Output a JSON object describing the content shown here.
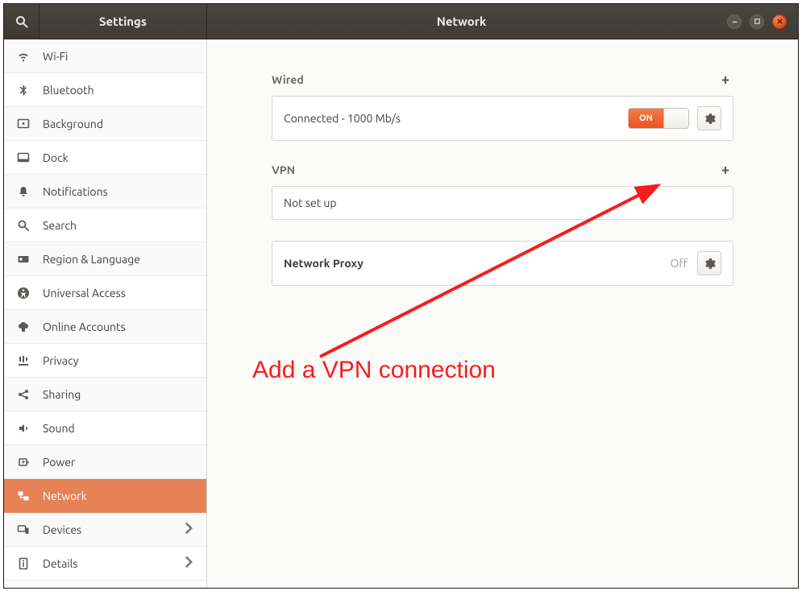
{
  "titlebar": {
    "sidebar_title": "Settings",
    "main_title": "Network"
  },
  "sidebar": {
    "items": [
      {
        "label": "Wi-Fi"
      },
      {
        "label": "Bluetooth"
      },
      {
        "label": "Background"
      },
      {
        "label": "Dock"
      },
      {
        "label": "Notifications"
      },
      {
        "label": "Search"
      },
      {
        "label": "Region & Language"
      },
      {
        "label": "Universal Access"
      },
      {
        "label": "Online Accounts"
      },
      {
        "label": "Privacy"
      },
      {
        "label": "Sharing"
      },
      {
        "label": "Sound"
      },
      {
        "label": "Power"
      },
      {
        "label": "Network"
      },
      {
        "label": "Devices"
      },
      {
        "label": "Details"
      }
    ]
  },
  "network": {
    "wired_header": "Wired",
    "wired_status": "Connected - 1000 Mb/s",
    "wired_toggle": "ON",
    "vpn_header": "VPN",
    "vpn_status": "Not set up",
    "proxy_label": "Network Proxy",
    "proxy_status": "Off"
  },
  "annotation": {
    "text": "Add a VPN connection"
  }
}
